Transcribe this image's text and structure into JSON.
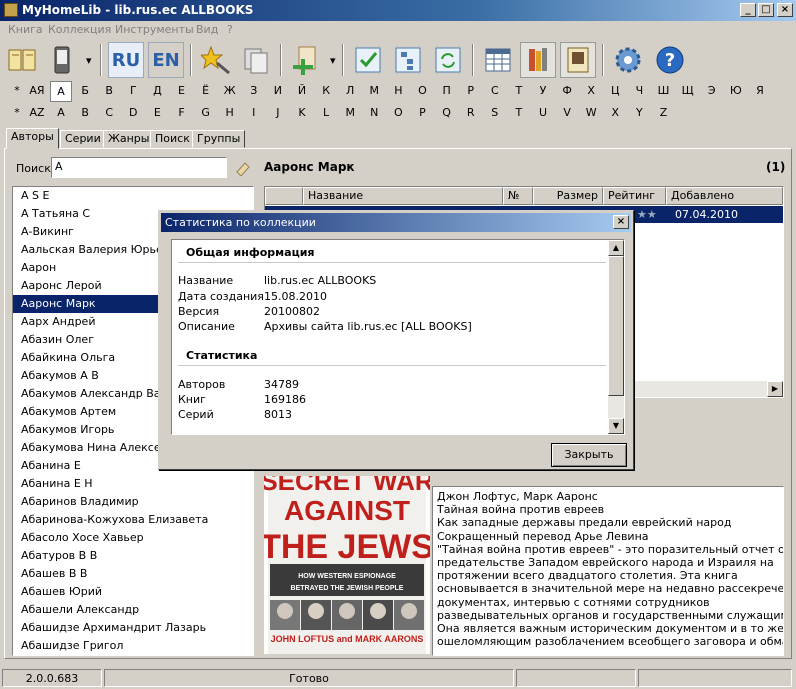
{
  "window": {
    "title": "MyHomeLib - lib.rus.ec ALLBOOKS"
  },
  "menu": [
    "Книга",
    "Коллекция",
    "Инструменты",
    "Вид",
    "?"
  ],
  "toolbar": {
    "lang_ru": "RU",
    "lang_en": "EN"
  },
  "alphabet_ru": [
    "*",
    "АЯ",
    "А",
    "Б",
    "В",
    "Г",
    "Д",
    "Е",
    "Ё",
    "Ж",
    "З",
    "И",
    "Й",
    "К",
    "Л",
    "М",
    "Н",
    "О",
    "П",
    "Р",
    "С",
    "Т",
    "У",
    "Ф",
    "Х",
    "Ц",
    "Ч",
    "Ш",
    "Щ",
    "Э",
    "Ю",
    "Я"
  ],
  "alphabet_en": [
    "*",
    "AZ",
    "A",
    "B",
    "C",
    "D",
    "E",
    "F",
    "G",
    "H",
    "I",
    "J",
    "K",
    "L",
    "M",
    "N",
    "O",
    "P",
    "Q",
    "R",
    "S",
    "T",
    "U",
    "V",
    "W",
    "X",
    "Y",
    "Z"
  ],
  "tabs": [
    "Авторы",
    "Серии",
    "Жанры",
    "Поиск",
    "Группы"
  ],
  "search": {
    "label": "Поиск",
    "value": "А"
  },
  "authors": [
    "A S E",
    "А Татьяна С",
    "А-Викинг",
    "Аальская Валерия Юрьевна",
    "Аарон",
    "Ааронс Лерой",
    "Ааронс Марк",
    "Аарх Андрей",
    "Абазин Олег",
    "Абайкина Ольга",
    "Абакумов А В",
    "Абакумов Александр Василь",
    "Абакумов Артем",
    "Абакумов Игорь",
    "Абакумова Нина Алексеевна",
    "Абанина Е",
    "Абанина Е Н",
    "Абаринов Владимир",
    "Абаринова-Кожухова Елизавета",
    "Абасоло Хосе Хавьер",
    "Абатуров В В",
    "Абашев В В",
    "Абашев Юрий",
    "Абашели Александр",
    "Абашидзе Архимандрит Лазарь",
    "Абашидзе Григол"
  ],
  "selected_author": "Ааронс Марк",
  "author_panel": {
    "title": "Ааронс Марк",
    "count": "(1)"
  },
  "book_columns": [
    "Название",
    "№",
    "Размер",
    "Рейтинг",
    "Добавлено"
  ],
  "book_row": {
    "rating": "★★",
    "added": "07.04.2010"
  },
  "cover": {
    "title_lines": [
      "SECRET WAR",
      "AGAINST",
      "THE JEWS"
    ],
    "subtitle_lines": [
      "HOW WESTERN ESPIONAGE",
      "BETRAYED THE JEWISH PEOPLE"
    ],
    "authors": "JOHN LOFTUS and MARK AARONS"
  },
  "annotation": [
    "Джон Лофтус, Марк Ааронс",
    "Тайная война против евреев",
    "Как западные державы предали еврейский народ",
    "Сокращенный перевод Арье Левина",
    "\"Тайная война против евреев\" - это поразительный отчет о",
    "предательстве Западом еврейского народа и Израиля на",
    "протяжении всего двадцатого столетия. Эта книга",
    "основывается в значительной мере на недавно рассекреченных",
    "документах, интервью с сотнями сотрудников",
    "разведывательных органов и государственными служащими.",
    "Она является важным историческим документом и в то же время",
    "ошеломляющим разоблачением всеобщего заговора и обмана."
  ],
  "statusbar": {
    "version": "2.0.0.683",
    "status": "Готово"
  },
  "dialog": {
    "title": "Статистика по коллекции",
    "general_header": "Общая информация",
    "name_label": "Название",
    "name_value": "lib.rus.ec ALLBOOKS",
    "created_label": "Дата создания",
    "created_value": "15.08.2010",
    "version_label": "Версия",
    "version_value": "20100802",
    "desc_label": "Описание",
    "desc_value": "Архивы сайта lib.rus.ec [ALL BOOKS]",
    "stats_header": "Статистика",
    "authors_label": "Авторов",
    "authors_value": "34789",
    "books_label": "Книг",
    "books_value": "169186",
    "series_label": "Серий",
    "series_value": "8013",
    "close_button": "Закрыть"
  }
}
